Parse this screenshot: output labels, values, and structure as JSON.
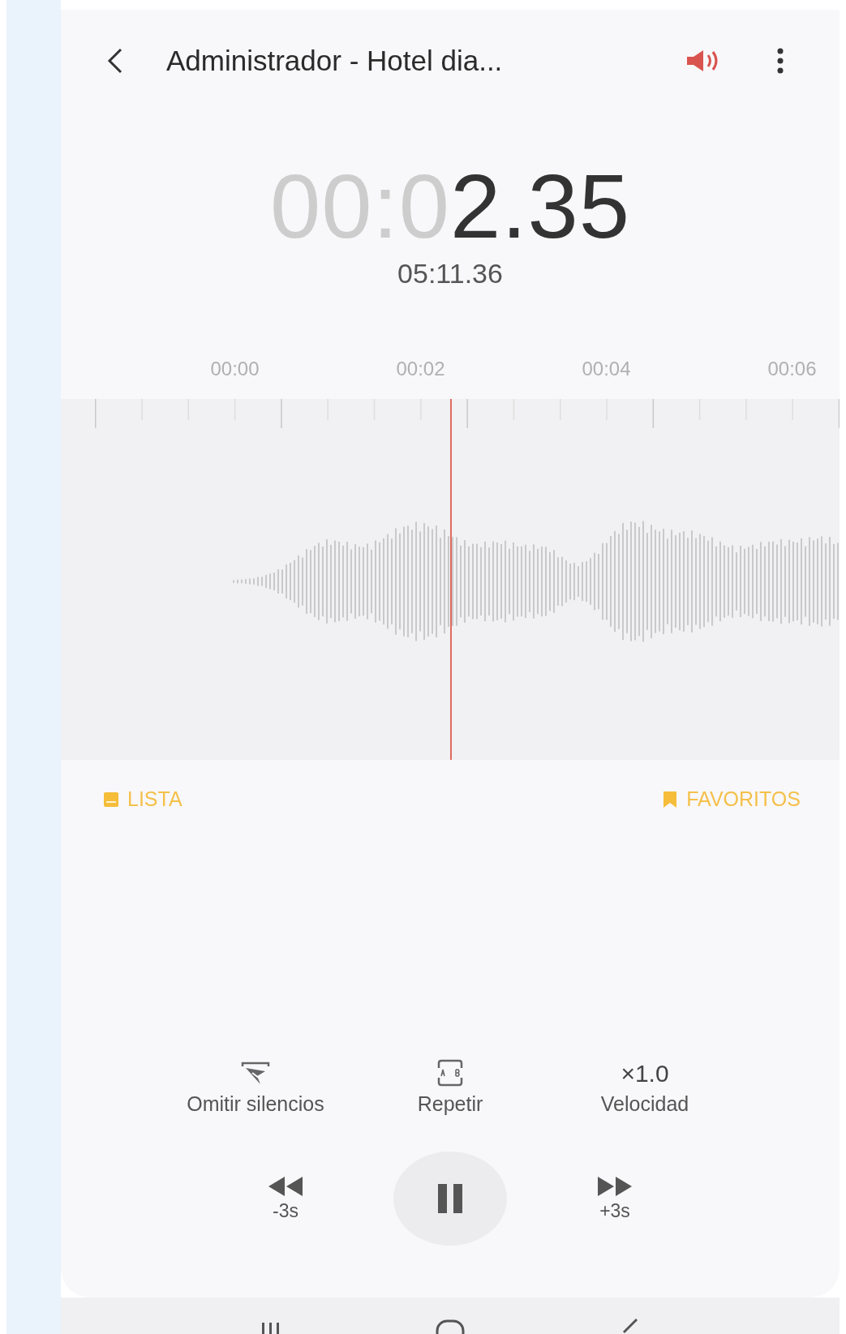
{
  "top_bar": {
    "title": "Administrador - Hotel dia..."
  },
  "timer": {
    "elapsed_dim": "00:0",
    "elapsed": "2.35",
    "total": "05:11.36"
  },
  "timeline": {
    "labels": [
      "00:00",
      "00:02",
      "00:04",
      "00:06"
    ]
  },
  "bookmarks": [
    {
      "kind": "list",
      "label": "LISTA"
    },
    {
      "kind": "favorite",
      "label": "FAVORITOS"
    }
  ],
  "options": [
    {
      "kind": "skip-silence",
      "label": "Omitir silencios"
    },
    {
      "kind": "repeat",
      "label": "Repetir"
    },
    {
      "kind": "speed",
      "value": "×1.0",
      "label": "Velocidad"
    }
  ],
  "transport": {
    "rewind": "-3s",
    "forward": "+3s",
    "playing": true
  }
}
